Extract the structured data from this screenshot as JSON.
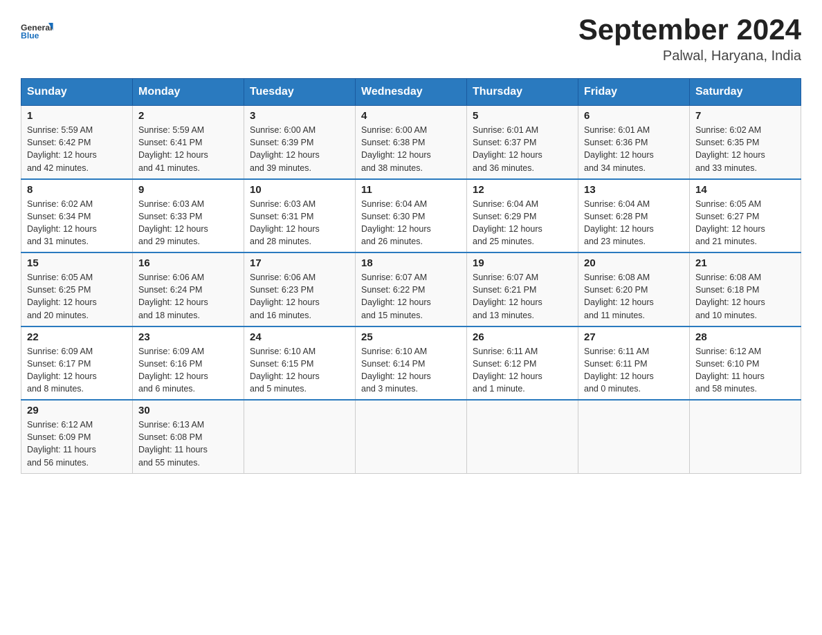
{
  "header": {
    "logo_general": "General",
    "logo_blue": "Blue",
    "month_year": "September 2024",
    "location": "Palwal, Haryana, India"
  },
  "days_of_week": [
    "Sunday",
    "Monday",
    "Tuesday",
    "Wednesday",
    "Thursday",
    "Friday",
    "Saturday"
  ],
  "weeks": [
    [
      {
        "day": "1",
        "sunrise": "5:59 AM",
        "sunset": "6:42 PM",
        "daylight": "12 hours and 42 minutes."
      },
      {
        "day": "2",
        "sunrise": "5:59 AM",
        "sunset": "6:41 PM",
        "daylight": "12 hours and 41 minutes."
      },
      {
        "day": "3",
        "sunrise": "6:00 AM",
        "sunset": "6:39 PM",
        "daylight": "12 hours and 39 minutes."
      },
      {
        "day": "4",
        "sunrise": "6:00 AM",
        "sunset": "6:38 PM",
        "daylight": "12 hours and 38 minutes."
      },
      {
        "day": "5",
        "sunrise": "6:01 AM",
        "sunset": "6:37 PM",
        "daylight": "12 hours and 36 minutes."
      },
      {
        "day": "6",
        "sunrise": "6:01 AM",
        "sunset": "6:36 PM",
        "daylight": "12 hours and 34 minutes."
      },
      {
        "day": "7",
        "sunrise": "6:02 AM",
        "sunset": "6:35 PM",
        "daylight": "12 hours and 33 minutes."
      }
    ],
    [
      {
        "day": "8",
        "sunrise": "6:02 AM",
        "sunset": "6:34 PM",
        "daylight": "12 hours and 31 minutes."
      },
      {
        "day": "9",
        "sunrise": "6:03 AM",
        "sunset": "6:33 PM",
        "daylight": "12 hours and 29 minutes."
      },
      {
        "day": "10",
        "sunrise": "6:03 AM",
        "sunset": "6:31 PM",
        "daylight": "12 hours and 28 minutes."
      },
      {
        "day": "11",
        "sunrise": "6:04 AM",
        "sunset": "6:30 PM",
        "daylight": "12 hours and 26 minutes."
      },
      {
        "day": "12",
        "sunrise": "6:04 AM",
        "sunset": "6:29 PM",
        "daylight": "12 hours and 25 minutes."
      },
      {
        "day": "13",
        "sunrise": "6:04 AM",
        "sunset": "6:28 PM",
        "daylight": "12 hours and 23 minutes."
      },
      {
        "day": "14",
        "sunrise": "6:05 AM",
        "sunset": "6:27 PM",
        "daylight": "12 hours and 21 minutes."
      }
    ],
    [
      {
        "day": "15",
        "sunrise": "6:05 AM",
        "sunset": "6:25 PM",
        "daylight": "12 hours and 20 minutes."
      },
      {
        "day": "16",
        "sunrise": "6:06 AM",
        "sunset": "6:24 PM",
        "daylight": "12 hours and 18 minutes."
      },
      {
        "day": "17",
        "sunrise": "6:06 AM",
        "sunset": "6:23 PM",
        "daylight": "12 hours and 16 minutes."
      },
      {
        "day": "18",
        "sunrise": "6:07 AM",
        "sunset": "6:22 PM",
        "daylight": "12 hours and 15 minutes."
      },
      {
        "day": "19",
        "sunrise": "6:07 AM",
        "sunset": "6:21 PM",
        "daylight": "12 hours and 13 minutes."
      },
      {
        "day": "20",
        "sunrise": "6:08 AM",
        "sunset": "6:20 PM",
        "daylight": "12 hours and 11 minutes."
      },
      {
        "day": "21",
        "sunrise": "6:08 AM",
        "sunset": "6:18 PM",
        "daylight": "12 hours and 10 minutes."
      }
    ],
    [
      {
        "day": "22",
        "sunrise": "6:09 AM",
        "sunset": "6:17 PM",
        "daylight": "12 hours and 8 minutes."
      },
      {
        "day": "23",
        "sunrise": "6:09 AM",
        "sunset": "6:16 PM",
        "daylight": "12 hours and 6 minutes."
      },
      {
        "day": "24",
        "sunrise": "6:10 AM",
        "sunset": "6:15 PM",
        "daylight": "12 hours and 5 minutes."
      },
      {
        "day": "25",
        "sunrise": "6:10 AM",
        "sunset": "6:14 PM",
        "daylight": "12 hours and 3 minutes."
      },
      {
        "day": "26",
        "sunrise": "6:11 AM",
        "sunset": "6:12 PM",
        "daylight": "12 hours and 1 minute."
      },
      {
        "day": "27",
        "sunrise": "6:11 AM",
        "sunset": "6:11 PM",
        "daylight": "12 hours and 0 minutes."
      },
      {
        "day": "28",
        "sunrise": "6:12 AM",
        "sunset": "6:10 PM",
        "daylight": "11 hours and 58 minutes."
      }
    ],
    [
      {
        "day": "29",
        "sunrise": "6:12 AM",
        "sunset": "6:09 PM",
        "daylight": "11 hours and 56 minutes."
      },
      {
        "day": "30",
        "sunrise": "6:13 AM",
        "sunset": "6:08 PM",
        "daylight": "11 hours and 55 minutes."
      },
      null,
      null,
      null,
      null,
      null
    ]
  ],
  "labels": {
    "sunrise_prefix": "Sunrise: ",
    "sunset_prefix": "Sunset: ",
    "daylight_prefix": "Daylight: "
  }
}
